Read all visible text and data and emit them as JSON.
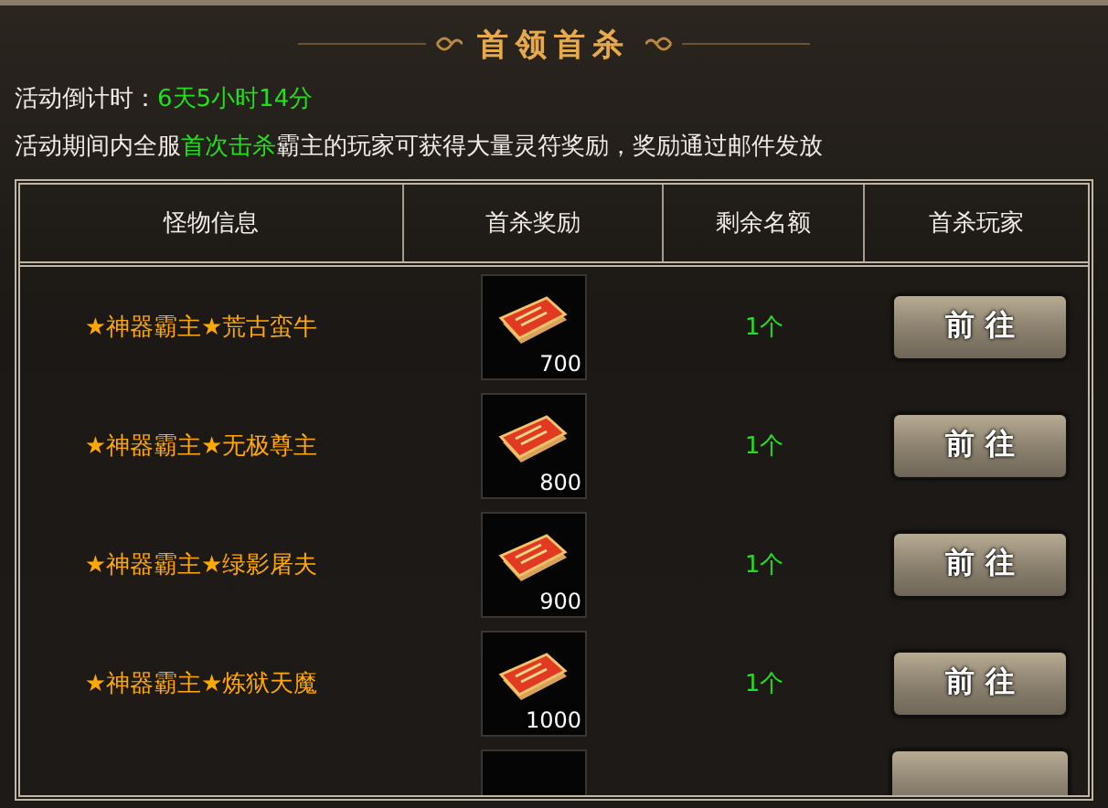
{
  "title": "首领首杀",
  "countdown": {
    "label": "活动倒计时：",
    "value": "6天5小时14分"
  },
  "description": "活动期间内全服**首次击杀**霸主的玩家可获得大量灵符奖励，奖励通过邮件发放",
  "table": {
    "columns": [
      "怪物信息",
      "首杀奖励",
      "剩余名额",
      "首杀玩家"
    ],
    "rows": [
      {
        "monster": "★神器霸主★荒古蛮牛",
        "reward_count": "700",
        "remaining": "1个",
        "button": "前 往"
      },
      {
        "monster": "★神器霸主★无极尊主",
        "reward_count": "800",
        "remaining": "1个",
        "button": "前 往"
      },
      {
        "monster": "★神器霸主★绿影屠夫",
        "reward_count": "900",
        "remaining": "1个",
        "button": "前 往"
      },
      {
        "monster": "★神器霸主★炼狱天魔",
        "reward_count": "1000",
        "remaining": "1个",
        "button": "前 往"
      }
    ]
  }
}
